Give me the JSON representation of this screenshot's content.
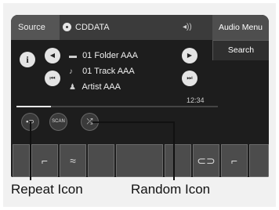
{
  "header": {
    "source_label": "Source",
    "media_label": "CDDATA",
    "volume_glyph": "◂))"
  },
  "menu": {
    "audio_menu_label": "Audio Menu",
    "search_label": "Search"
  },
  "now_playing": {
    "folder": "01 Folder AAA",
    "track": "01 Track AAA",
    "artist": "Artist AAA",
    "elapsed_time": "12:34",
    "progress_fraction": 0.17
  },
  "buttons": {
    "info_glyph": "i",
    "prev_folder_glyph": "◀",
    "next_folder_glyph": "▶",
    "skip_back_glyph": "⏮",
    "skip_forward_glyph": "⏭",
    "repeat_glyph": "▪⊃",
    "scan_label": "SCAN",
    "random_glyph": "⤮"
  },
  "icons": {
    "folder": "folder-icon",
    "track": "music-note-icon",
    "artist": "artist-icon"
  },
  "callouts": {
    "repeat_label": "Repeat Icon",
    "random_label": "Random Icon"
  }
}
